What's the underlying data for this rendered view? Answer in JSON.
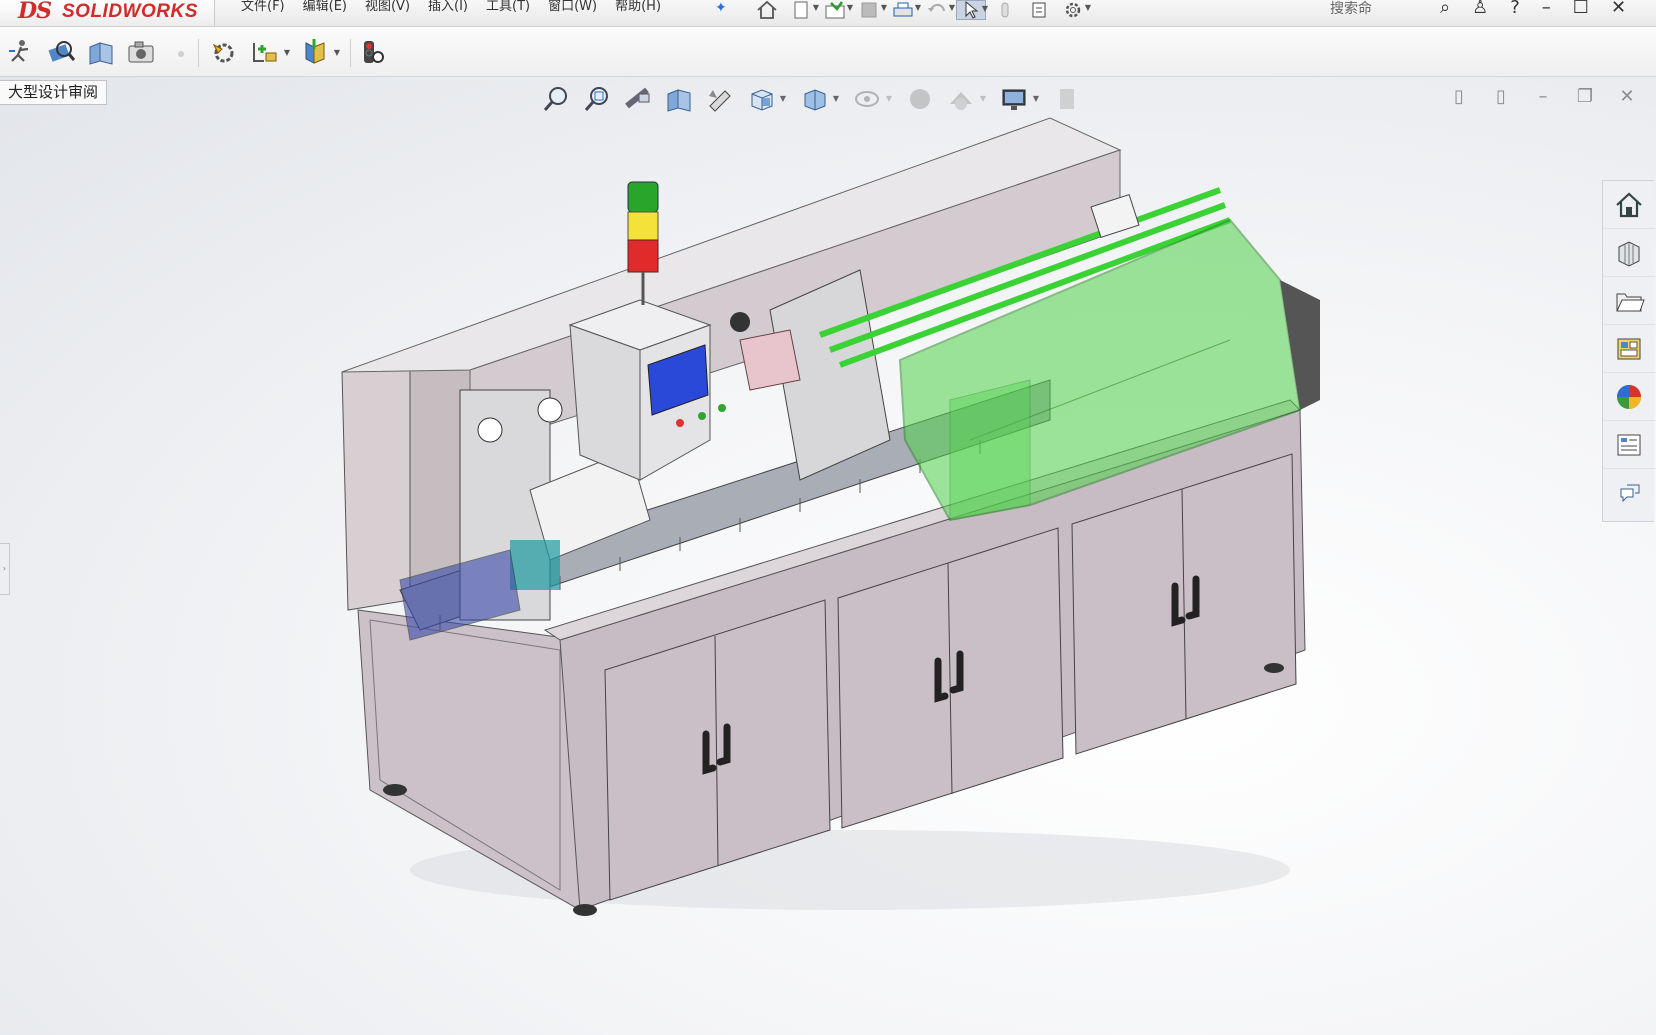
{
  "app": {
    "brand_ds": "DS",
    "brand_name": "SOLIDWORKS"
  },
  "menu": [
    "文件(F)",
    "编辑(E)",
    "视图(V)",
    "插入(I)",
    "工具(T)",
    "窗口(W)",
    "帮助(H)"
  ],
  "title_tools": [
    "home-icon",
    "new-document-icon",
    "open-icon",
    "save-icon",
    "print-icon",
    "undo-icon",
    "select-icon",
    "rebuild-icon",
    "file-properties-icon",
    "options-icon"
  ],
  "search": {
    "label": "搜索命",
    "placeholder": "搜索命令"
  },
  "command_bar": [
    "smart-dimension-icon",
    "inspect-icon",
    "section-view-icon",
    "screenshot-icon",
    "assembly-config-icon",
    "insert-component-icon",
    "mate-icon",
    "traffic-light-icon"
  ],
  "document_tab": "大型设计审阅",
  "heads_up_toolbar": [
    "zoom-to-fit-icon",
    "zoom-area-icon",
    "previous-view-icon",
    "section-view-icon",
    "dynamic-annotation-icon",
    "view-orientation-icon",
    "display-style-icon",
    "hide-show-icon",
    "edit-appearance-icon",
    "apply-scene-icon",
    "view-settings-icon",
    "display-pane-icon"
  ],
  "task_pane": [
    "solidworks-resources-icon",
    "design-library-icon",
    "file-explorer-icon",
    "view-palette-icon",
    "appearances-icon",
    "custom-properties-icon",
    "solidworks-forum-icon"
  ],
  "colors": {
    "brand_red": "#d12c2c",
    "machine_body": "#c9bcc4",
    "guard_green": "#4fd24a",
    "screen_blue": "#2a49d8"
  }
}
